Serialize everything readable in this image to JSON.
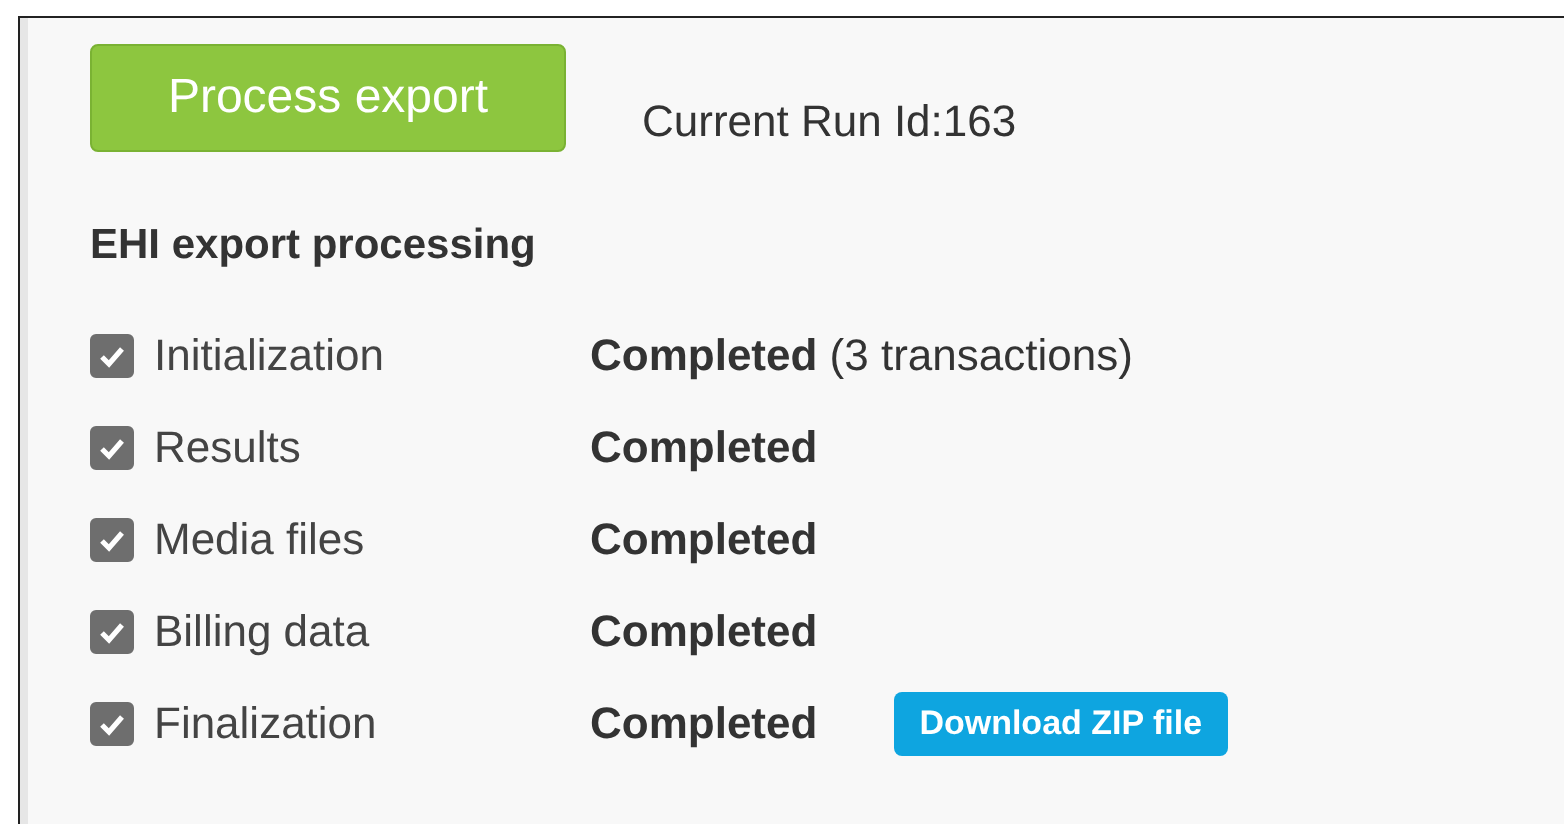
{
  "process_button": "Process export",
  "run_id": "Current Run Id:163",
  "heading": "EHI export processing",
  "steps": [
    {
      "label": "Initialization",
      "checked": true,
      "status": "**Completed** (3 transactions)"
    },
    {
      "label": "Results",
      "checked": true,
      "status": "**Completed**"
    },
    {
      "label": "Media files",
      "checked": true,
      "status": "**Completed**"
    },
    {
      "label": "Billing data",
      "checked": true,
      "status": "**Completed**"
    },
    {
      "label": "Finalization",
      "checked": true,
      "status": "**Completed**",
      "action": "Download ZIP file"
    }
  ]
}
